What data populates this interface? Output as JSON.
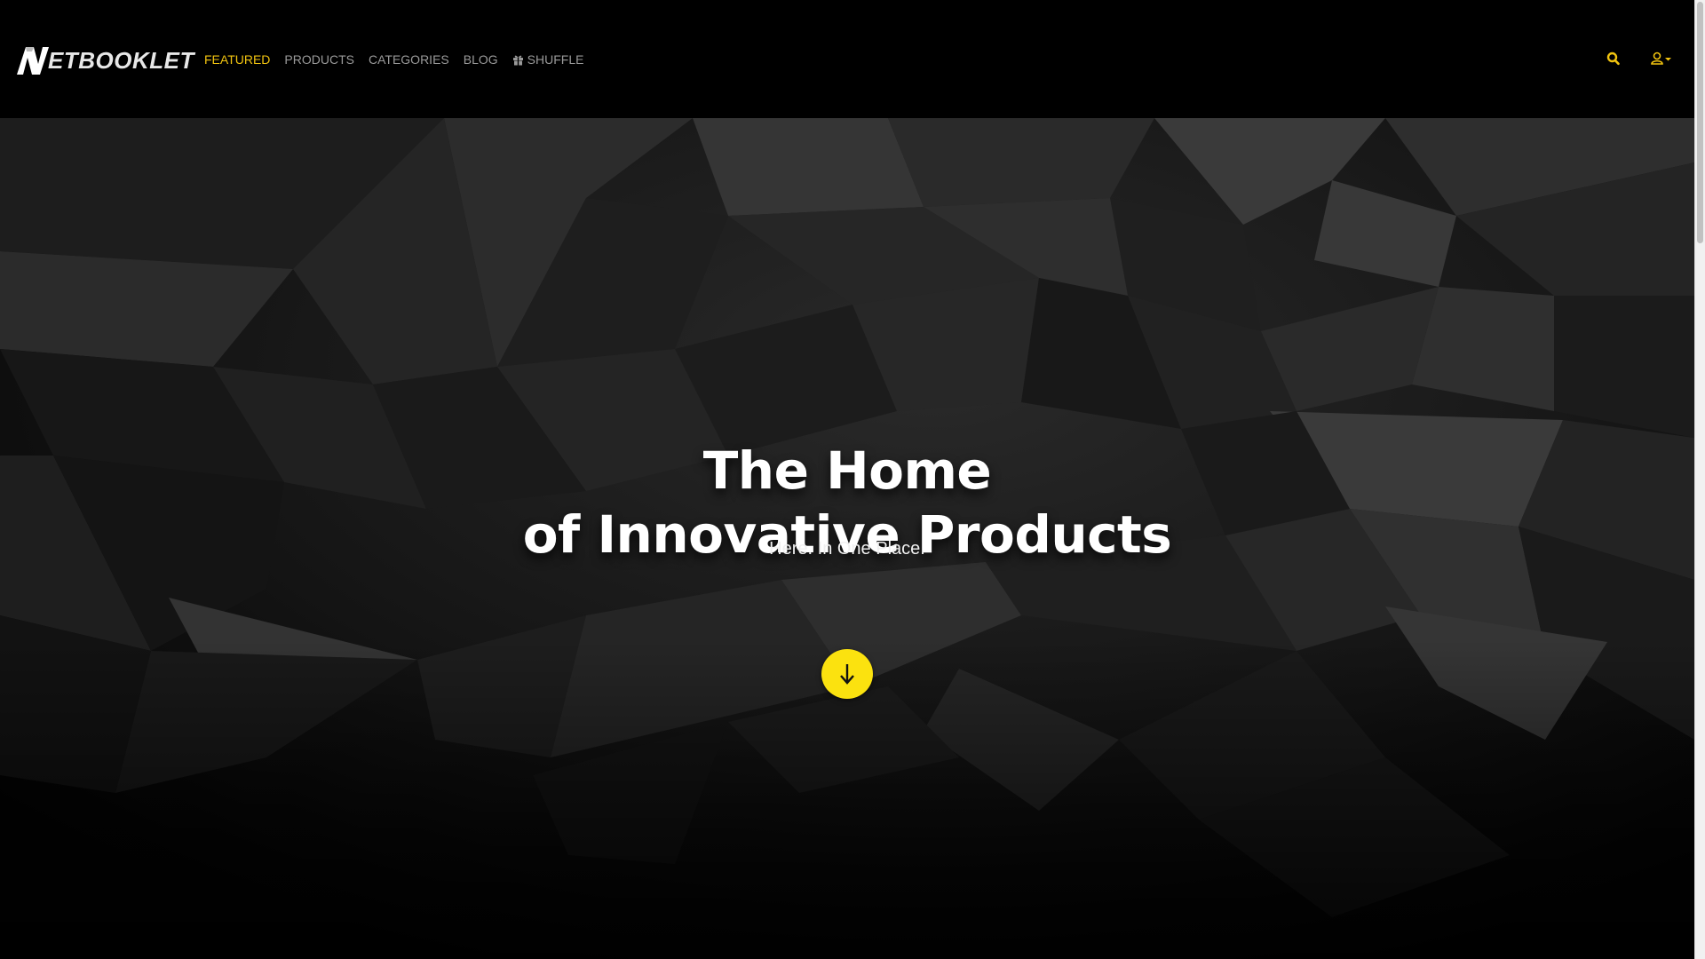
{
  "brand": {
    "logo_letter": "N",
    "name_rest": "ETBOOKLET"
  },
  "nav": {
    "items": [
      {
        "label": "FEATURED",
        "active": true
      },
      {
        "label": "PRODUCTS",
        "active": false
      },
      {
        "label": "CATEGORIES",
        "active": false
      },
      {
        "label": "BLOG",
        "active": false
      },
      {
        "label": "SHUFFLE",
        "active": false,
        "icon": "gift-icon"
      }
    ],
    "search_icon": "search-icon",
    "user_icon": "user-icon",
    "user_dropdown_icon": "caret-down-icon"
  },
  "hero": {
    "title_line1": "The Home",
    "title_line2": "of Innovative Products",
    "subtitle": "Here. In One Place.",
    "scroll_icon": "arrow-down-icon"
  },
  "colors": {
    "accent": "#f2c40f",
    "button": "#fbe20f",
    "background": "#000000",
    "nav_text": "#9a9a9a"
  }
}
